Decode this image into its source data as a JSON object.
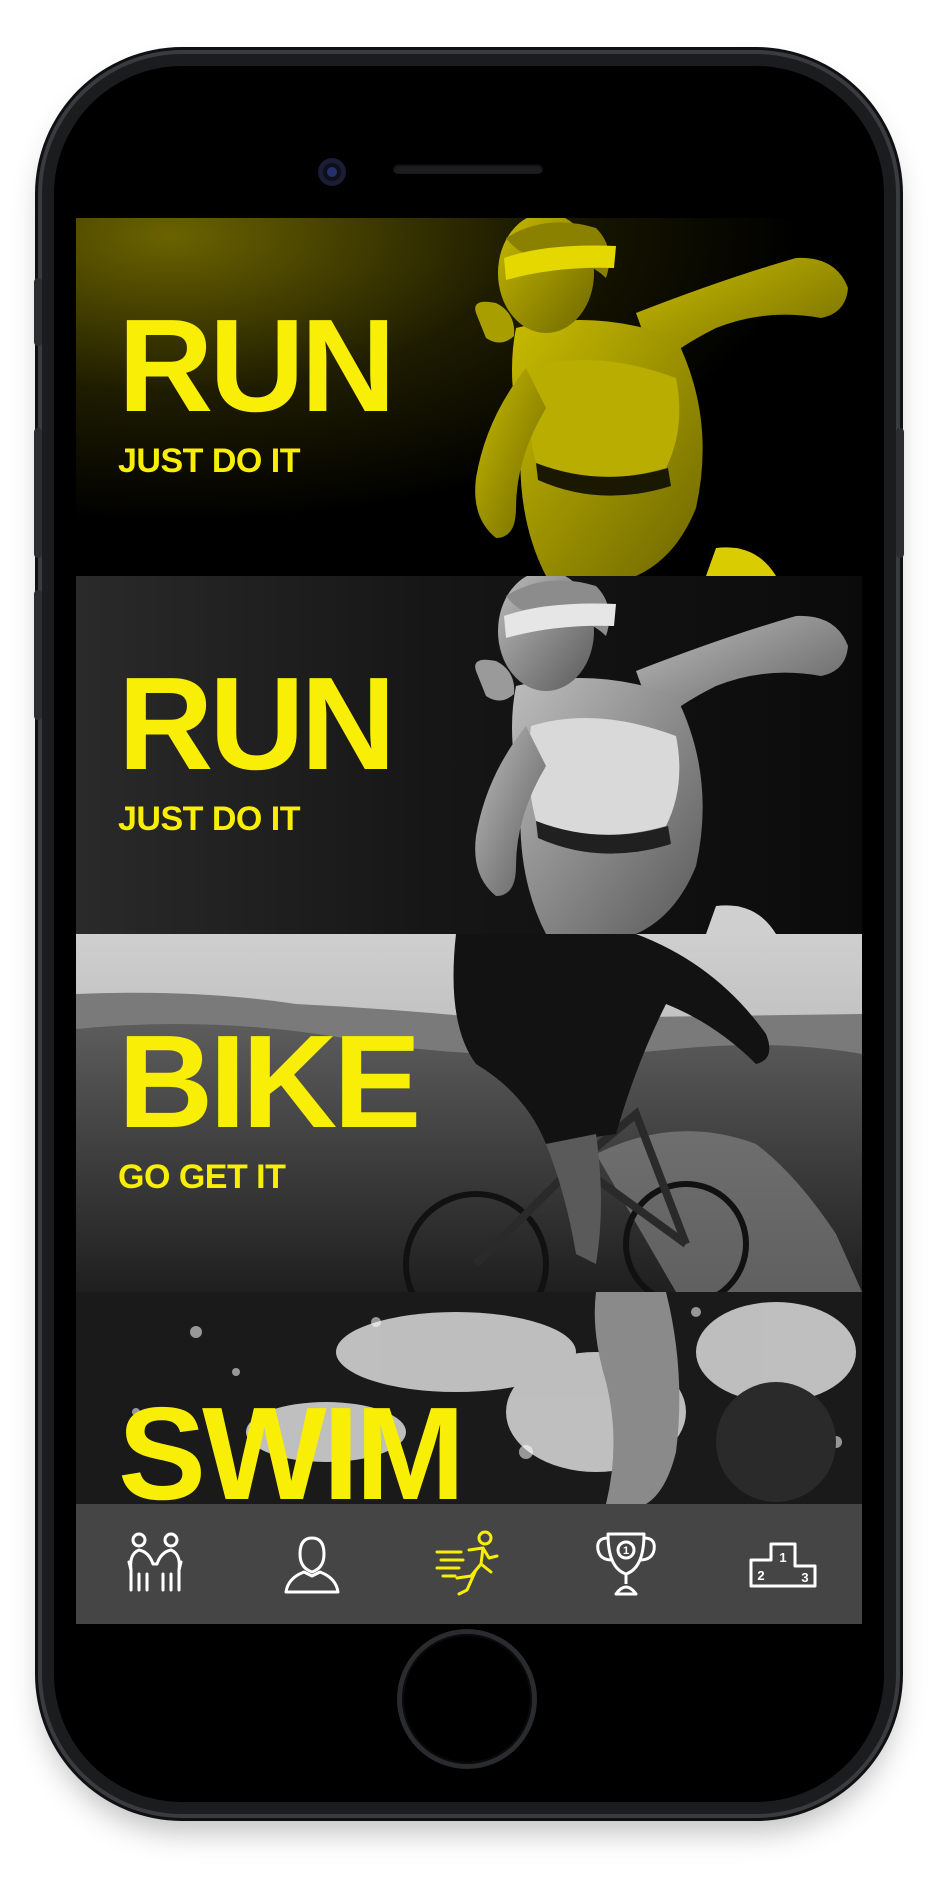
{
  "panels": [
    {
      "title": "RUN",
      "subtitle": "JUST DO IT",
      "theme": "yellow"
    },
    {
      "title": "RUN",
      "subtitle": "JUST DO IT",
      "theme": "mono"
    },
    {
      "title": "BIKE",
      "subtitle": "GO GET IT",
      "theme": "mono"
    },
    {
      "title": "SWIM",
      "subtitle": "",
      "theme": "mono"
    }
  ],
  "tabbar": {
    "items": [
      {
        "icon": "people-handshake-icon",
        "active": false
      },
      {
        "icon": "profile-icon",
        "active": false
      },
      {
        "icon": "runner-icon",
        "active": true
      },
      {
        "icon": "trophy-icon",
        "active": false
      },
      {
        "icon": "podium-icon",
        "active": false
      }
    ],
    "active_color": "#f8ee06",
    "inactive_color": "#ffffff",
    "background": "#454545"
  },
  "colors": {
    "accent": "#f8ee06",
    "screen_background": "#000000"
  }
}
